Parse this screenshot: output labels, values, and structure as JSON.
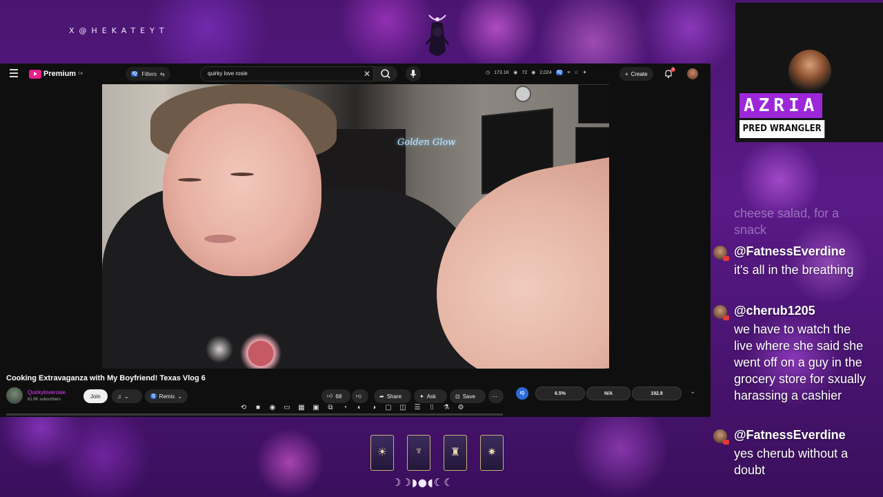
{
  "overlay": {
    "handle": "X@HEKATEYT",
    "moon_phases": "☽☽◗●◖☾☾"
  },
  "youtube": {
    "logo": "Premium",
    "logo_region": "CA",
    "filters_label": "Filters",
    "search_value": "quirky love rosie",
    "stats": [
      "173.1K",
      "72",
      "2,024"
    ],
    "create_label": "Create",
    "notification_count": "3"
  },
  "video": {
    "neon_sign": "Golden Glow",
    "title": "Cooking Extravaganza with My Boyfriend! Texas Vlog 6",
    "channel_name": "Quirkyloverosie",
    "subscribers": "61.6K subscribers",
    "join_label": "Join",
    "remix_label": "Remix",
    "like_count": "68",
    "share_label": "Share",
    "ask_label": "Ask",
    "save_label": "Save",
    "metrics": [
      "6.5%",
      "N/A",
      "192.8"
    ]
  },
  "cam": {
    "name": "AZRIA",
    "role": "PRED WRANGLER"
  },
  "chat": {
    "faded_text": "cheese salad, for a snack",
    "messages": [
      {
        "user": "@FatnessEverdine",
        "text": "it's all in the breathing"
      },
      {
        "user": "@cherub1205",
        "text": "we have to watch the live where she said she went off on a guy in the grocery store for sxually harassing a cashier"
      },
      {
        "user": "@FatnessEverdine",
        "text": "yes cherub without a doubt"
      }
    ]
  },
  "colors": {
    "accent_purple": "#9c27d8",
    "channel_pink": "#e040fb",
    "youtube_bg": "#0f0f0f"
  }
}
